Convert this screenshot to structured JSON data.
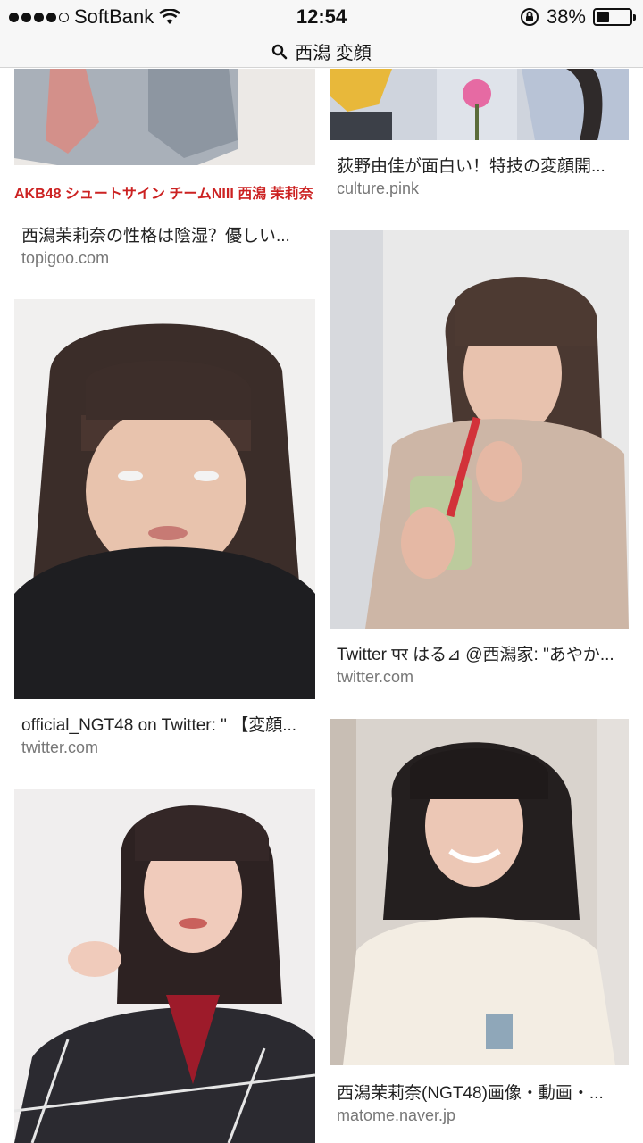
{
  "status_bar": {
    "carrier": "SoftBank",
    "time": "12:54",
    "battery": "38%",
    "battery_level": 0.38,
    "icons": [
      "signal-dots",
      "wifi-icon",
      "orientation-lock-icon",
      "battery-icon"
    ]
  },
  "search": {
    "query": "西潟 変顔"
  },
  "results": [
    {
      "title": "西潟茉莉奈の性格は陰湿？優しい...",
      "domain": "topigoo.com",
      "overlay": "AKB48 シュートサイン チームNIII 西潟 茉莉奈"
    },
    {
      "title": "荻野由佳が面白い！特技の変顔開...",
      "domain": "culture.pink"
    },
    {
      "title": "official_NGT48 on Twitter: \" 【変顔...",
      "domain": "twitter.com"
    },
    {
      "title": "Twitter पर はる⊿ @西潟家: \"あやか...",
      "domain": "twitter.com"
    },
    {
      "title": "西潟茉莉奈(NGT48)画像・動画・...",
      "domain": "matome.naver.jp"
    },
    {
      "title": "",
      "domain": ""
    }
  ]
}
